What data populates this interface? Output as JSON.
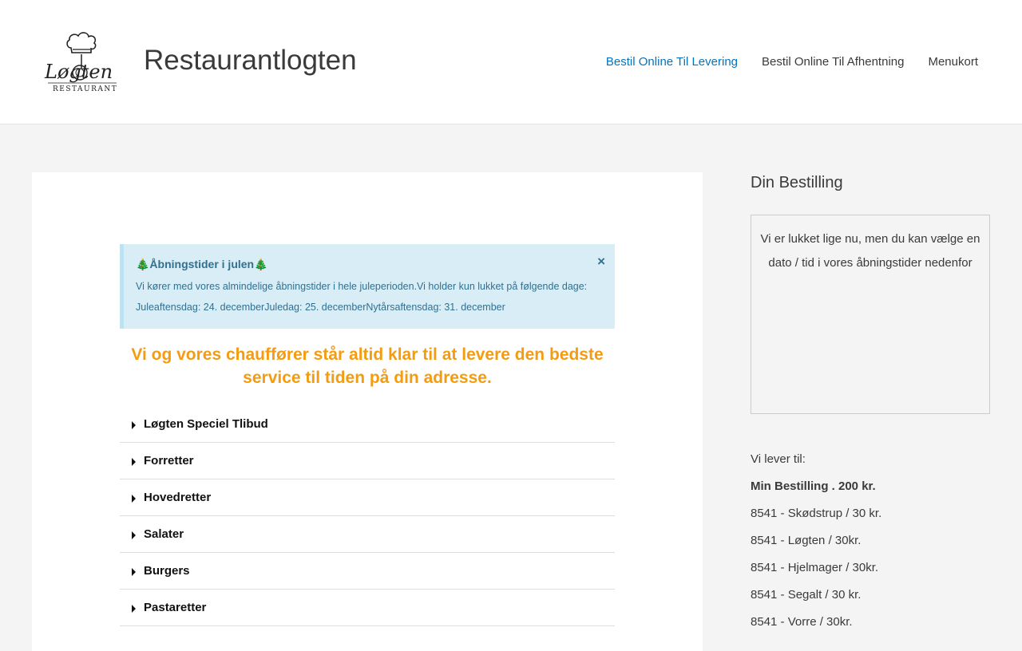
{
  "header": {
    "logo_text_main": "Løgten",
    "logo_text_sub": "RESTAURANT",
    "site_title": "Restaurantlogten",
    "nav": [
      {
        "label": "Bestil Online Til Levering",
        "active": true
      },
      {
        "label": "Bestil Online Til Afhentning",
        "active": false
      },
      {
        "label": "Menukort",
        "active": false
      }
    ]
  },
  "notice": {
    "title": "🎄Åbningstider i julen🎄",
    "body": "Vi kører med vores almindelige åbningstider i hele juleperioden.Vi holder kun lukket på følgende dage: Juleaftensdag: 24. decemberJuledag: 25. decemberNytårsaftensdag: 31. december",
    "close": "×"
  },
  "promo": "Vi og vores chauffører står altid klar til at levere den bedste service til tiden på din adresse.",
  "menu_categories": [
    "Løgten Speciel Tlibud",
    "Forretter",
    "Hovedretter",
    "Salater",
    "Burgers",
    "Pastaretter"
  ],
  "sidebar": {
    "title": "Din Bestilling",
    "order_message": "Vi er lukket lige nu, men du kan vælge en dato / tid i vores åbningstider nedenfor",
    "delivery_heading": "Vi lever til:",
    "min_order": "Min Bestilling . 200 kr.",
    "areas": [
      "8541 - Skødstrup / 30 kr.",
      "8541 - Løgten / 30kr.",
      "8541 - Hjelmager / 30kr.",
      "8541 - Segalt / 30 kr.",
      "8541 - Vorre / 30kr."
    ]
  },
  "colors": {
    "accent": "#0274be",
    "promo": "#f39c12",
    "notice_bg": "#d9edf7",
    "notice_text": "#31708f"
  }
}
